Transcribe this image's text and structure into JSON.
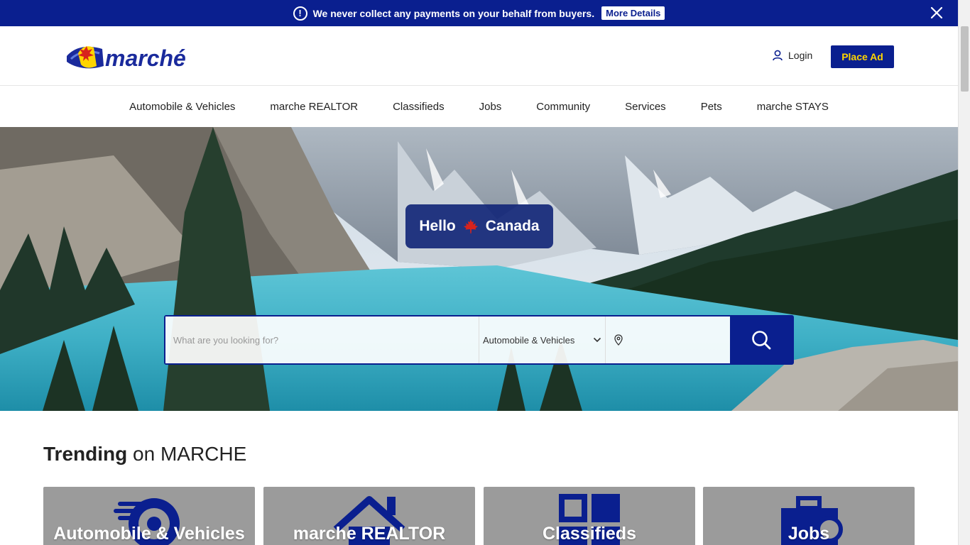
{
  "banner": {
    "message": "We never collect any payments on your behalf from buyers.",
    "button_label": "More Details",
    "info_icon_glyph": "!"
  },
  "header": {
    "logo_text": "marché",
    "login_label": "Login",
    "place_ad_label": "Place Ad"
  },
  "nav": {
    "items": [
      "Automobile & Vehicles",
      "marche REALTOR",
      "Classifieds",
      "Jobs",
      "Community",
      "Services",
      "Pets",
      "marche STAYS"
    ]
  },
  "hero": {
    "greeting_left": "Hello",
    "greeting_right": "Canada",
    "search_placeholder": "What are you looking for?",
    "category_value": "Automobile & Vehicles"
  },
  "trending": {
    "title_bold": "Trending",
    "title_rest": "on MARCHE",
    "cards": [
      {
        "label": "Automobile & Vehicles",
        "icon": "car-wheel-icon"
      },
      {
        "label": "marche REALTOR",
        "icon": "house-icon"
      },
      {
        "label": "Classifieds",
        "icon": "grid-icon"
      },
      {
        "label": "Jobs",
        "icon": "briefcase-search-icon"
      }
    ]
  },
  "colors": {
    "brand_blue": "#0a1f8f",
    "accent_yellow": "#ffd500",
    "maple_red": "#d8231c",
    "card_gray": "#9b9b9b"
  }
}
